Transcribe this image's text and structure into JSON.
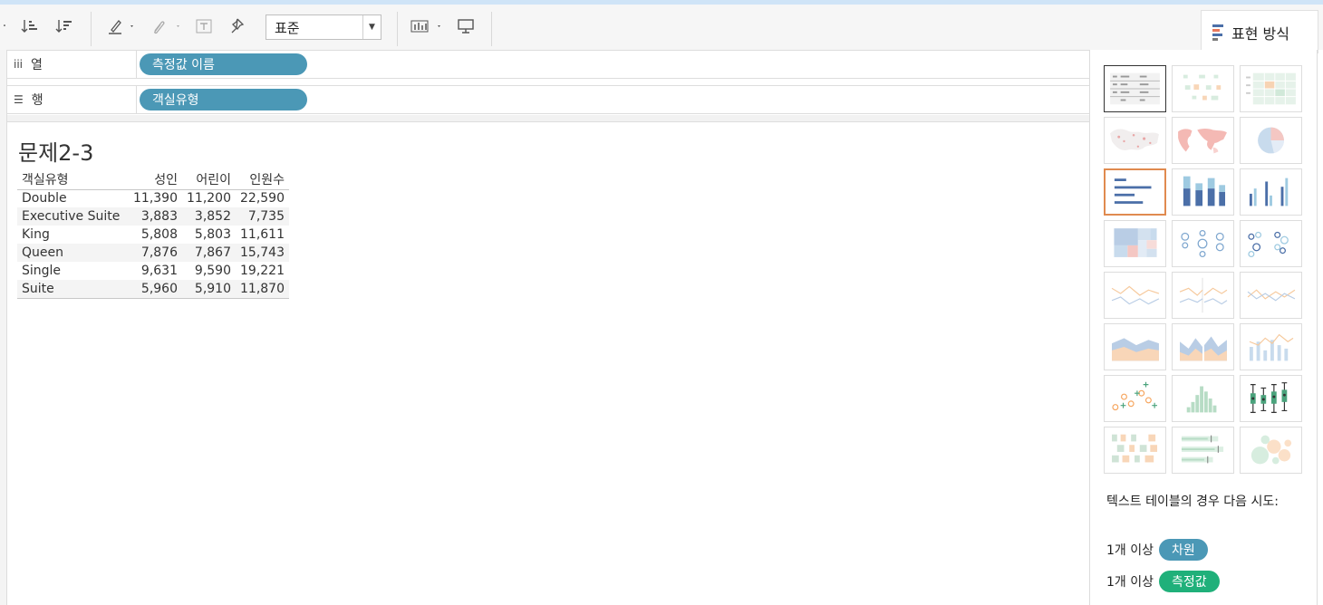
{
  "toolbar": {
    "fit_select": "표준",
    "show_me_tab": "표현 방식"
  },
  "shelves": {
    "columns": {
      "label": "열",
      "pill": "측정값 이름"
    },
    "rows": {
      "label": "행",
      "pill": "객실유형"
    }
  },
  "sheet": {
    "title": "문제2-3",
    "table": {
      "row_header": "객실유형",
      "columns": [
        "성인",
        "어린이",
        "인원수"
      ],
      "rows": [
        {
          "name": "Double",
          "values": [
            "11,390",
            "11,200",
            "22,590"
          ]
        },
        {
          "name": "Executive Suite",
          "values": [
            "3,883",
            "3,852",
            "7,735"
          ]
        },
        {
          "name": "King",
          "values": [
            "5,808",
            "5,803",
            "11,611"
          ]
        },
        {
          "name": "Queen",
          "values": [
            "7,876",
            "7,867",
            "15,743"
          ]
        },
        {
          "name": "Single",
          "values": [
            "9,631",
            "9,590",
            "19,221"
          ]
        },
        {
          "name": "Suite",
          "values": [
            "5,960",
            "5,910",
            "11,870"
          ]
        }
      ]
    }
  },
  "show_me": {
    "hint_text": "텍스트 테이블의 경우 다음 시도:",
    "requirements": [
      {
        "prefix": "1개 이상",
        "pill": "차원",
        "color": "#4b98b6"
      },
      {
        "prefix": "1개 이상",
        "pill": "측정값",
        "color": "#20b07a"
      }
    ],
    "thumbnails": [
      "text-table",
      "heat-map",
      "highlight-table",
      "symbol-map",
      "filled-map",
      "pie-chart",
      "horizontal-bars",
      "stacked-bars",
      "side-by-side-bars",
      "treemap",
      "circle-views",
      "side-by-side-circles",
      "lines-continuous",
      "lines-discrete",
      "dual-lines",
      "area-continuous",
      "area-discrete",
      "dual-combination",
      "scatter-plot",
      "histogram",
      "box-and-whisker",
      "gantt",
      "bullet-graph",
      "packed-bubbles"
    ]
  },
  "colors": {
    "pill_blue": "#4b98b6",
    "pill_green": "#20b07a",
    "selected_outline": "#e08a4f"
  }
}
